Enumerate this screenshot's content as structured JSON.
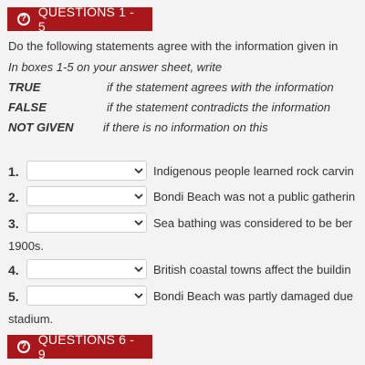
{
  "sections": {
    "first_title": "QUESTIONS 1 - 5",
    "second_title": "QUESTIONS 6 - 9",
    "icon": "question-circle-icon"
  },
  "intro": "Do the following statements agree with the information given in",
  "instructions": "In boxes 1-5 on your answer sheet, write",
  "key": [
    {
      "term": "TRUE",
      "meaning": "if the statement agrees with the information"
    },
    {
      "term": "FALSE",
      "meaning": "if the statement contradicts the information"
    },
    {
      "term": "NOT GIVEN",
      "meaning": "if there is no information on this"
    }
  ],
  "questions": [
    {
      "number": "1.",
      "text": "Indigenous people learned rock carvin",
      "continuation": ""
    },
    {
      "number": "2.",
      "text": "Bondi Beach was not a public gatherin",
      "continuation": ""
    },
    {
      "number": "3.",
      "text": "Sea bathing was considered to be ber",
      "continuation": "1900s."
    },
    {
      "number": "4.",
      "text": "British coastal towns affect the buildin",
      "continuation": ""
    },
    {
      "number": "5.",
      "text": "Bondi Beach was partly damaged due",
      "continuation": "stadium."
    }
  ],
  "colors": {
    "header_bg": "#a9171b",
    "header_text": "#ffffff",
    "page_bg": "#f3f3f3"
  }
}
